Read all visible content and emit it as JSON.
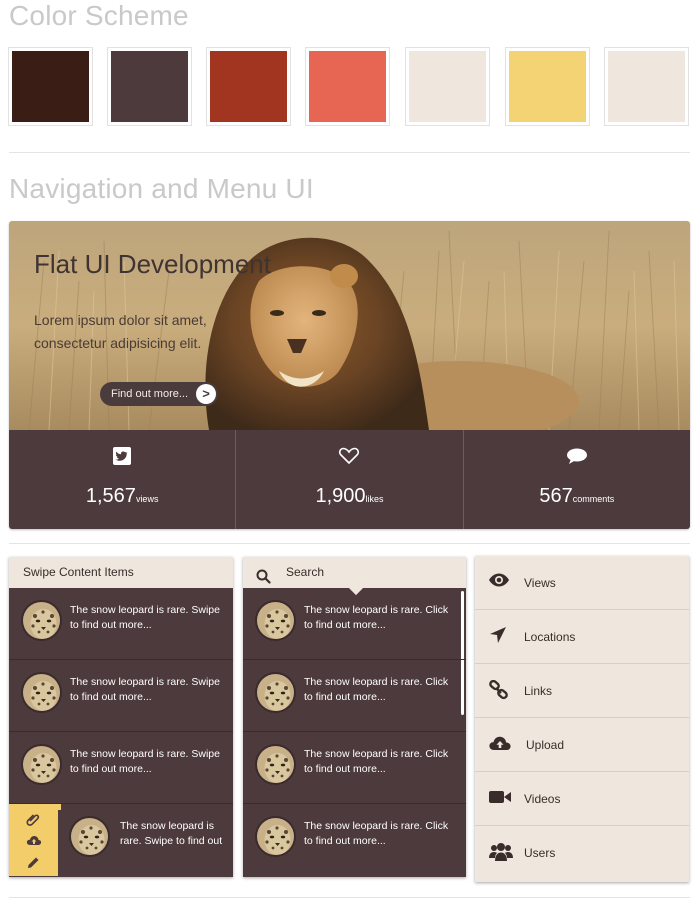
{
  "sections": {
    "color_scheme_title": "Color Scheme",
    "navigation_title": "Navigation and Menu UI"
  },
  "swatches": [
    "#3a1d14",
    "#4d3a3c",
    "#a13520",
    "#e76553",
    "#efe7dd",
    "#f4d374",
    "#efe7dd"
  ],
  "hero": {
    "title": "Flat UI Development",
    "text_line1": "Lorem ipsum dolor sit amet,",
    "text_line2": "consectetur adipisicing elit.",
    "button_label": "Find out more...",
    "button_arrow": ">"
  },
  "stats": [
    {
      "icon": "twitter-icon",
      "value": "1,567",
      "unit": "views"
    },
    {
      "icon": "heart-icon",
      "value": "1,900",
      "unit": "likes"
    },
    {
      "icon": "comment-icon",
      "value": "567",
      "unit": "comments"
    }
  ],
  "swipe_panel": {
    "header": "Swipe Content Items",
    "items": [
      "The snow leopard is rare. Swipe to find out more...",
      "The snow leopard is rare. Swipe to find out more...",
      "The snow leopard is rare. Swipe to find out more...",
      "The snow leopard is rare. Swipe to find out"
    ],
    "swiped_actions": [
      "paperclip-icon",
      "cloud-upload-icon",
      "pencil-icon"
    ]
  },
  "search_panel": {
    "header": "Search",
    "items": [
      "The snow leopard is rare. Click to find out more...",
      "The snow leopard is rare. Click to find out more...",
      "The snow leopard is rare. Click to find out more...",
      "The snow leopard is rare. Click to find out more..."
    ]
  },
  "menu": [
    {
      "icon": "eye-icon",
      "label": "Views"
    },
    {
      "icon": "location-arrow-icon",
      "label": "Locations"
    },
    {
      "icon": "link-icon",
      "label": "Links"
    },
    {
      "icon": "cloud-upload-icon",
      "label": "Upload"
    },
    {
      "icon": "video-camera-icon",
      "label": "Videos"
    },
    {
      "icon": "users-icon",
      "label": "Users"
    }
  ],
  "colors": {
    "dark_brown": "#4d3a3c",
    "cream": "#efe7dd",
    "yellow": "#f4cd6b"
  }
}
